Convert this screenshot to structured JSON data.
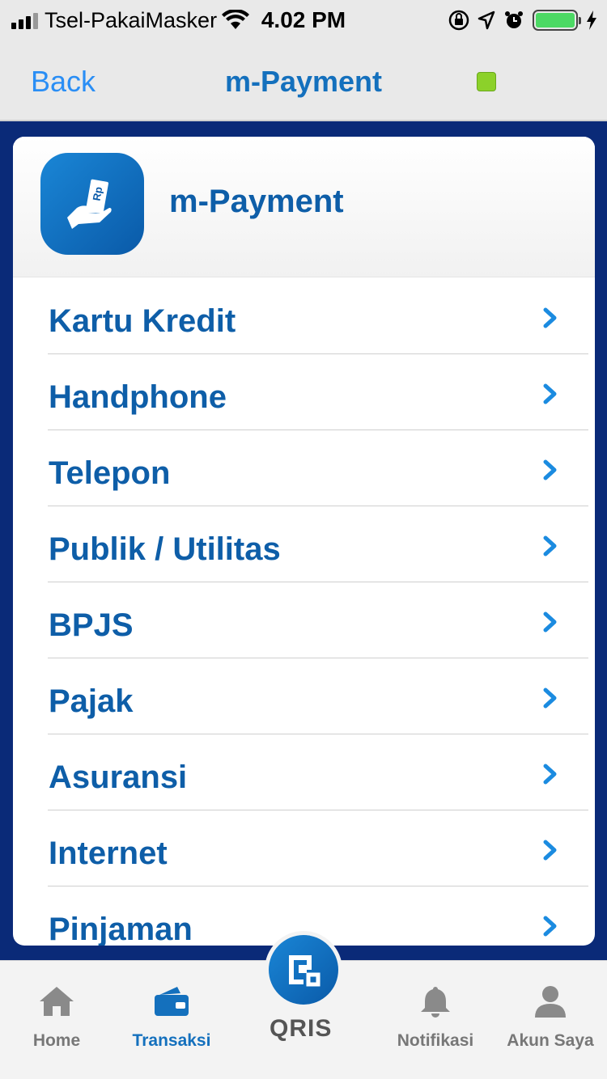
{
  "status_bar": {
    "carrier": "Tsel-PakaiMasker",
    "time": "4.02 PM",
    "battery_color": "#4cd964"
  },
  "nav": {
    "back_label": "Back",
    "title": "m-Payment",
    "indicator_color": "#8cd12a"
  },
  "card": {
    "title": "m-Payment",
    "icon": "payment-hand-cash-icon"
  },
  "menu": [
    {
      "label": "Kartu Kredit"
    },
    {
      "label": "Handphone"
    },
    {
      "label": "Telepon"
    },
    {
      "label": "Publik / Utilitas"
    },
    {
      "label": "BPJS"
    },
    {
      "label": "Pajak"
    },
    {
      "label": "Asuransi"
    },
    {
      "label": "Internet"
    },
    {
      "label": "Pinjaman"
    }
  ],
  "tabs": [
    {
      "label": "Home",
      "icon": "home-icon",
      "active": false
    },
    {
      "label": "Transaksi",
      "icon": "wallet-icon",
      "active": true
    },
    {
      "label": "Notifikasi",
      "icon": "bell-icon",
      "active": false
    },
    {
      "label": "Akun Saya",
      "icon": "user-icon",
      "active": false
    }
  ],
  "qris": {
    "label": "QRIS",
    "icon": "qris-icon"
  },
  "colors": {
    "accent": "#1470bd",
    "link": "#2a8ef5",
    "background": "#0a2a78"
  }
}
